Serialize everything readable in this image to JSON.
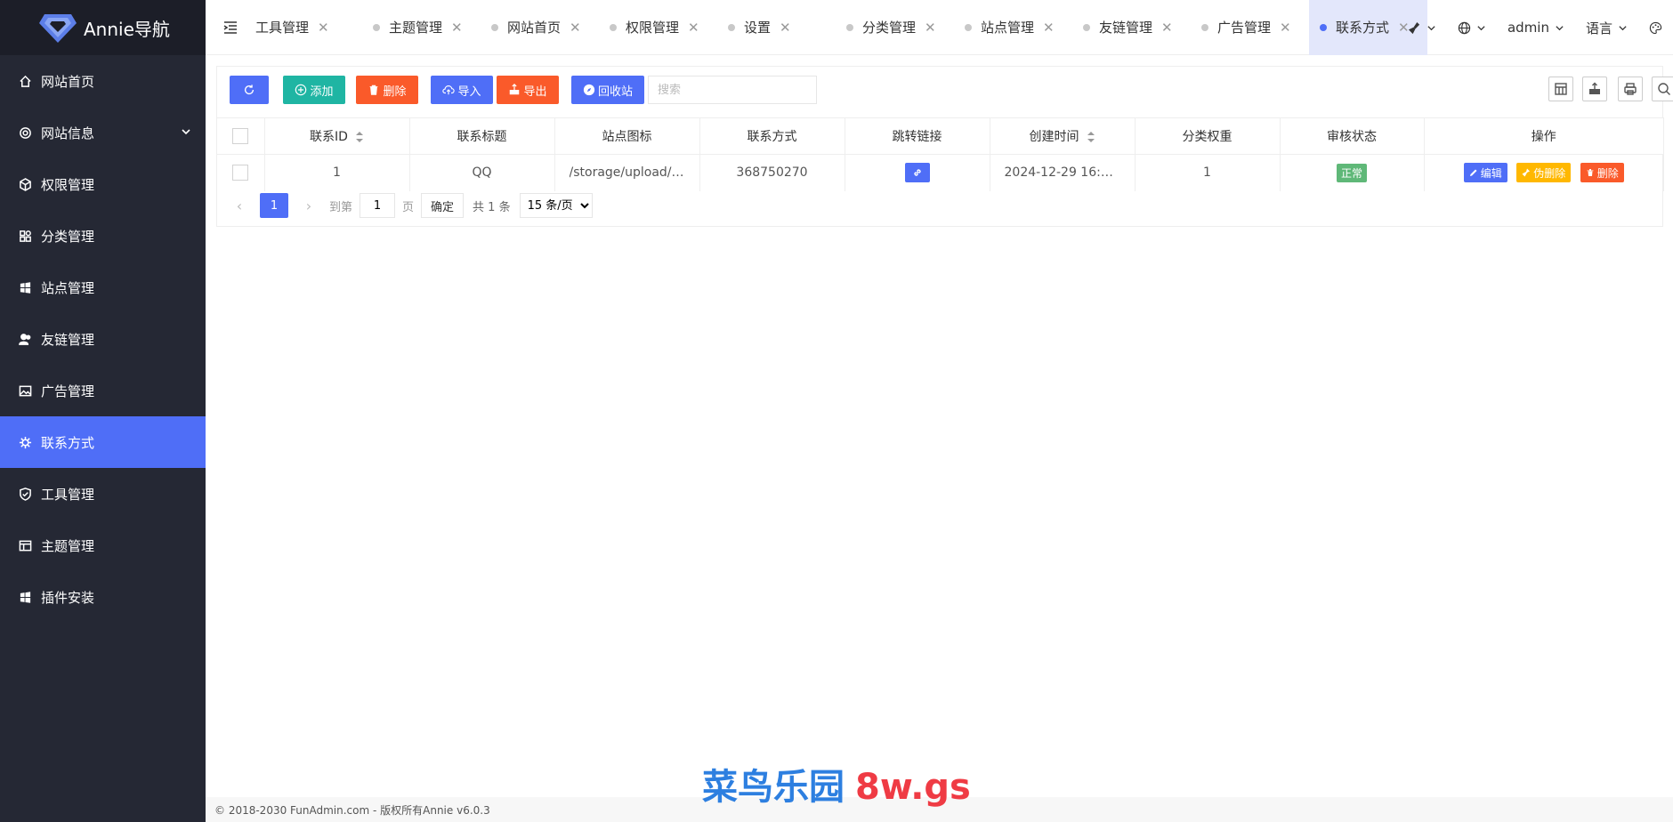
{
  "app": {
    "title": "Annie导航"
  },
  "sidebar": {
    "items": [
      {
        "label": "网站首页",
        "icon": "home-icon"
      },
      {
        "label": "网站信息",
        "icon": "gear-icon",
        "expandable": true
      },
      {
        "label": "权限管理",
        "icon": "cube-icon"
      },
      {
        "label": "分类管理",
        "icon": "apps-icon"
      },
      {
        "label": "站点管理",
        "icon": "windows-icon"
      },
      {
        "label": "友链管理",
        "icon": "users-icon"
      },
      {
        "label": "广告管理",
        "icon": "image-icon"
      },
      {
        "label": "联系方式",
        "icon": "bug-icon",
        "active": true
      },
      {
        "label": "工具管理",
        "icon": "shield-icon"
      },
      {
        "label": "主题管理",
        "icon": "layout-icon"
      },
      {
        "label": "插件安装",
        "icon": "windows-icon"
      }
    ]
  },
  "tabs": [
    {
      "label": "工具管理"
    },
    {
      "label": "主题管理"
    },
    {
      "label": "网站首页"
    },
    {
      "label": "权限管理"
    },
    {
      "label": "设置"
    },
    {
      "label": "分类管理"
    },
    {
      "label": "站点管理"
    },
    {
      "label": "友链管理"
    },
    {
      "label": "广告管理"
    },
    {
      "label": "联系方式",
      "active": true
    }
  ],
  "header": {
    "user": "admin",
    "language": "语言"
  },
  "toolbar": {
    "add": "添加",
    "delete": "删除",
    "import": "导入",
    "export": "导出",
    "recycle": "回收站",
    "search_placeholder": "搜索"
  },
  "table": {
    "columns": [
      "联系ID",
      "联系标题",
      "站点图标",
      "联系方式",
      "跳转链接",
      "创建时间",
      "分类权重",
      "审核状态",
      "操作"
    ],
    "rows": [
      {
        "id": "1",
        "title": "QQ",
        "icon": "/storage/upload/2...",
        "contact": "368750270",
        "created": "2024-12-29 16:1...",
        "weight": "1",
        "status": "正常"
      }
    ],
    "actions": {
      "edit": "编辑",
      "soft_delete": "伪删除",
      "delete": "删除"
    }
  },
  "pager": {
    "current": "1",
    "goto_label": "到第",
    "page_value": "1",
    "page_unit": "页",
    "confirm": "确定",
    "total": "共 1 条",
    "page_size": "15 条/页"
  },
  "footer": {
    "text": "© 2018-2030 FunAdmin.com - 版权所有Annie v6.0.3"
  },
  "watermark": {
    "part1": "菜鸟乐园",
    "part2": "8w.gs"
  },
  "colors": {
    "primary": "#4f6ef7",
    "sidebar": "#252834",
    "teal": "#1fb5a3",
    "orange": "#fa5a2a",
    "yellow": "#ffb800",
    "green": "#5fb878"
  }
}
